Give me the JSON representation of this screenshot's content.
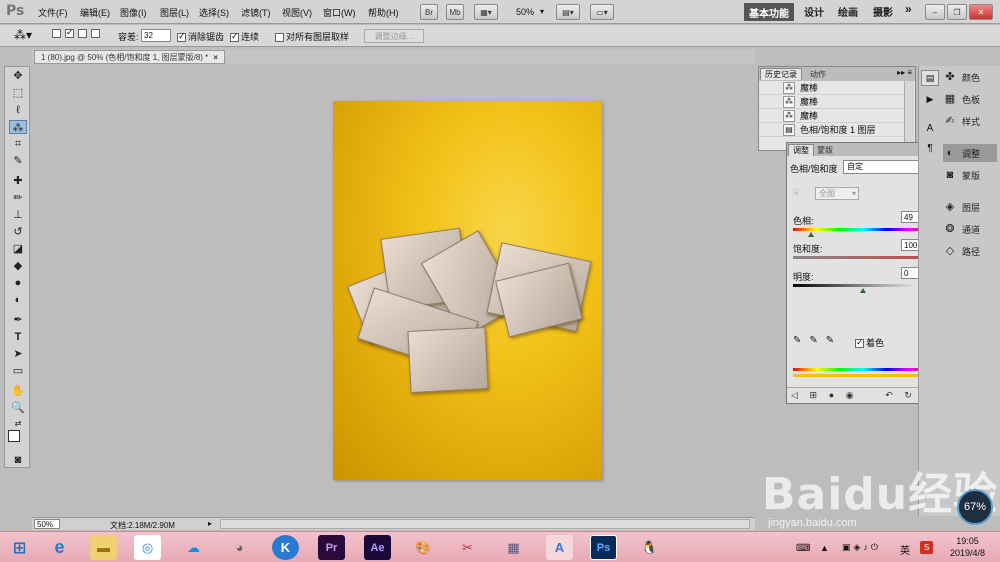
{
  "app": {
    "logo": "Ps"
  },
  "menu": [
    "文件(F)",
    "编辑(E)",
    "图像(I)",
    "图层(L)",
    "选择(S)",
    "滤镜(T)",
    "视图(V)",
    "窗口(W)",
    "帮助(H)"
  ],
  "appbar": {
    "br": "Br",
    "mb": "Mb",
    "zoom": "50%"
  },
  "workspaces": {
    "active": "基本功能",
    "items": [
      "设计",
      "绘画",
      "摄影"
    ],
    "more": "»"
  },
  "options": {
    "tolerance_label": "容差:",
    "tolerance": "32",
    "antialias": "消除锯齿",
    "contiguous": "连续",
    "sample_all": "对所有图层取样",
    "refine_edge": "调整边缘..."
  },
  "document": {
    "tab": "1 (80).jpg @ 50% (色相/饱和度 1, 图层蒙版/8) *",
    "close": "×"
  },
  "status": {
    "zoom": "50%",
    "doc": "文档:2.18M/2.90M"
  },
  "history": {
    "tabs": [
      "历史记录",
      "动作"
    ],
    "rows": [
      "魔棒",
      "魔棒",
      "魔棒",
      "色相/饱和度 1 图层"
    ]
  },
  "adjustments": {
    "tabs": [
      "调整",
      "蒙版"
    ],
    "title": "色相/饱和度",
    "preset": "自定",
    "channel": "全图",
    "hue_label": "色相:",
    "hue": "49",
    "sat_label": "饱和度:",
    "sat": "100",
    "light_label": "明度:",
    "light": "0",
    "colorize": "着色"
  },
  "dock": {
    "group1": [
      "颜色",
      "色板",
      "样式"
    ],
    "group2": [
      "调整",
      "蒙版"
    ],
    "group3": [
      "图层",
      "通道",
      "路径"
    ]
  },
  "taskbar": {
    "time": "19:05",
    "date": "2019/4/8",
    "lang": "英"
  },
  "watermark": {
    "text": "Baidu经验",
    "url": "jingyan.baidu.com"
  },
  "gauge": {
    "value": "67%"
  },
  "colors": {
    "photo_bg": "#f2c21a",
    "panel": "#e2e2e2",
    "taskbar": "#eab0bb"
  }
}
